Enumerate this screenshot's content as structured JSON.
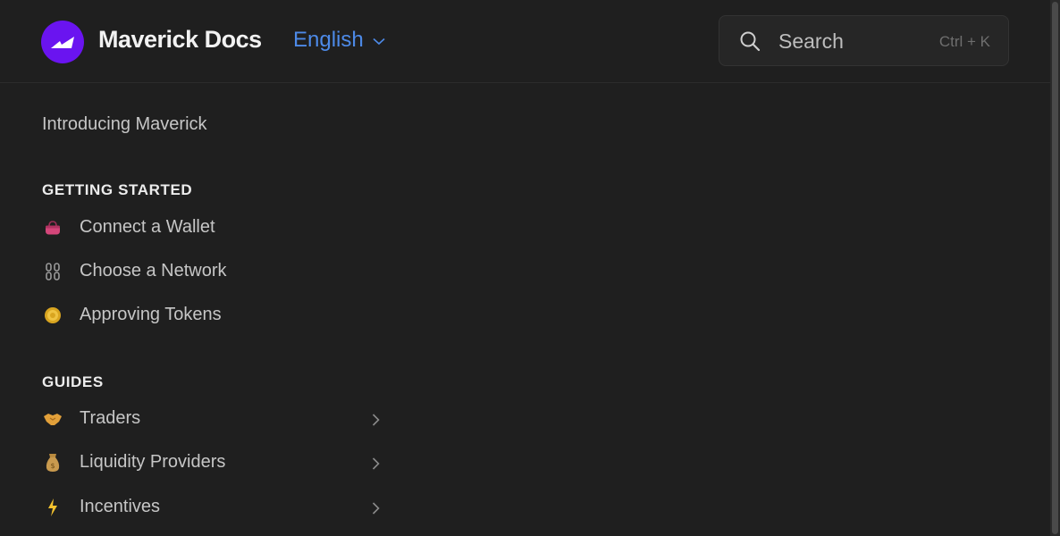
{
  "header": {
    "site_title": "Maverick Docs",
    "language": "English",
    "search_placeholder": "Search",
    "search_shortcut": "Ctrl + K"
  },
  "nav": {
    "intro_link": "Introducing Maverick",
    "sections": [
      {
        "title": "GETTING STARTED",
        "items": [
          {
            "label": "Connect a Wallet",
            "icon": "purse-icon"
          },
          {
            "label": "Choose a Network",
            "icon": "chain-icon"
          },
          {
            "label": "Approving Tokens",
            "icon": "coin-icon"
          }
        ]
      },
      {
        "title": "GUIDES",
        "items": [
          {
            "label": "Traders",
            "icon": "handshake-icon",
            "expandable": true
          },
          {
            "label": "Liquidity Providers",
            "icon": "money-bag-icon",
            "expandable": true
          },
          {
            "label": "Incentives",
            "icon": "lightning-icon",
            "expandable": true
          }
        ]
      }
    ]
  },
  "colors": {
    "background": "#1f1f1f",
    "accent_link": "#4d8ae8",
    "logo": "#6a14f0"
  }
}
